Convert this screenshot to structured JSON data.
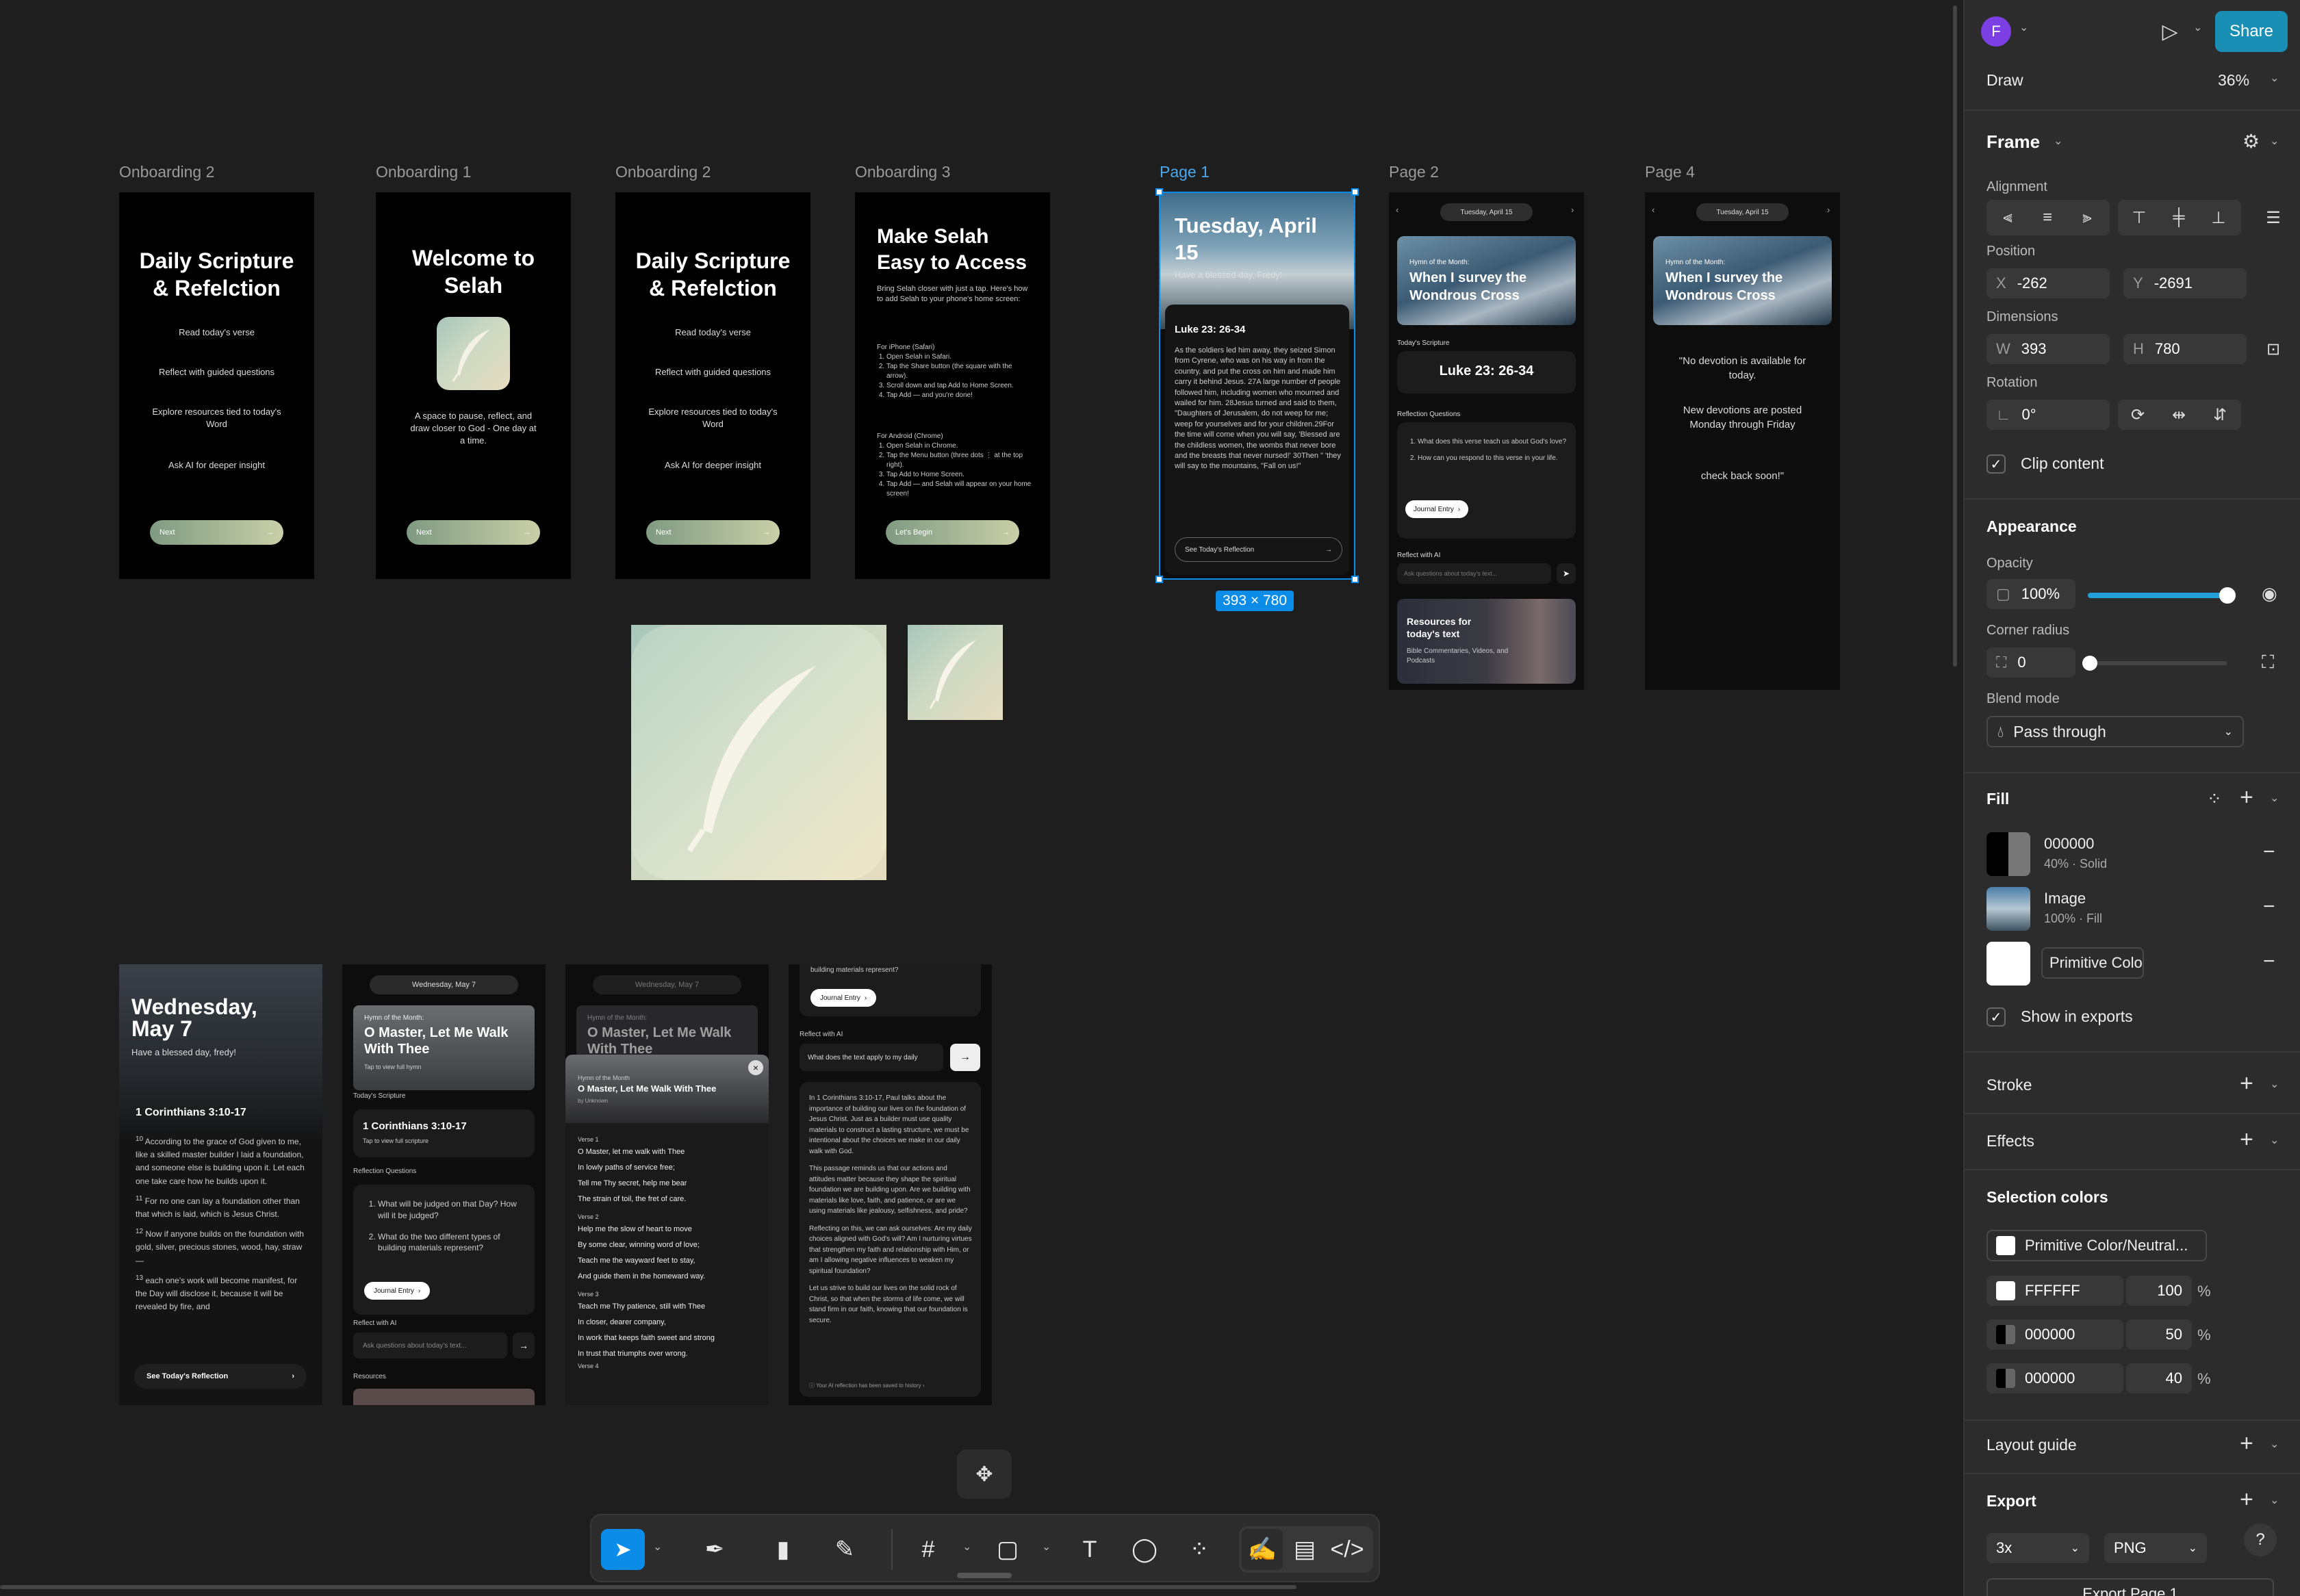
{
  "canvas": {
    "top_frames": [
      {
        "label": "Onboarding 2",
        "title": "Daily Scripture & Refelction",
        "items": [
          "Read today's verse",
          "Reflect with guided questions",
          "Explore resources tied to today's Word",
          "Ask AI for deeper insight"
        ],
        "button": "Next"
      },
      {
        "label": "Onboarding 1",
        "title": "Welcome to Selah",
        "body": "A space to pause, reflect, and draw closer to God - One day at a time.",
        "button": "Next"
      },
      {
        "label": "Onboarding 2",
        "title": "Daily Scripture & Refelction",
        "items": [
          "Read today's verse",
          "Reflect with guided questions",
          "Explore resources tied to today's Word",
          "Ask AI for deeper insight"
        ],
        "button": "Next"
      },
      {
        "label": "Onboarding 3",
        "title": "Make Selah Easy to Access",
        "intro": "Bring Selah closer with just a tap. Here's how to add Selah to your phone's home screen:",
        "iphone_head": "For iPhone (Safari)",
        "iphone_steps": [
          "Open Selah in Safari.",
          "Tap the Share button (the square with the arrow).",
          "Scroll down and tap Add to Home Screen.",
          "Tap Add — and you're done!"
        ],
        "android_head": "For Android (Chrome)",
        "android_steps": [
          "Open Selah in Chrome.",
          "Tap the Menu button (three dots ⋮ at the top right).",
          "Tap Add to Home Screen.",
          "Tap Add — and Selah will appear on your home screen!"
        ],
        "button": "Let's Begin"
      }
    ],
    "page1": {
      "label": "Page 1",
      "date": "Tuesday, April 15",
      "greeting": "Have a blessed day, Fredy!",
      "ref": "Luke 23: 26-34",
      "text": "As the soldiers led him away, they seized Simon from Cyrene, who was on his way in from the country, and put the cross on him and made him carry it behind Jesus. 27A large number of people followed him, including women who mourned and wailed for him. 28Jesus turned and said to them, \"Daughters of Jerusalem, do not weep for me; weep for yourselves and for your children.29For the time will come when you will say, 'Blessed are the childless women, the wombs that never bore and the breasts that never nursed!' 30Then \" 'they will say to the mountains, \"Fall on us!\"",
      "button": "See Today's Reflection",
      "size_badge": "393 × 780"
    },
    "page2": {
      "label": "Page 2",
      "date": "Tuesday, April 15",
      "hymn_kicker": "Hymn of the Month:",
      "hymn_title": "When I survey the Wondrous Cross",
      "scripture_label": "Today's Scripture",
      "scripture_ref": "Luke 23: 26-34",
      "reflection_label": "Reflection Questions",
      "questions": [
        "What does this verse teach us about God's love?",
        "How can you respond to this verse in your life."
      ],
      "journal": "Journal Entry",
      "ai_label": "Reflect with AI",
      "ai_placeholder": "Ask questions about today's text...",
      "res_title": "Resources for today's text",
      "res_sub": "Bible Commentaries, Videos, and Podcasts"
    },
    "page4": {
      "label": "Page 4",
      "date": "Tuesday, April 15",
      "hymn_kicker": "Hymn of the Month:",
      "hymn_title": "When I survey the Wondrous Cross",
      "msg1": "\"No devotion is available for today.",
      "msg2": "New devotions are posted Monday through Friday",
      "msg3": "check back soon!\""
    },
    "bottom": {
      "f1": {
        "date": "Wednesday, May 7",
        "greeting": "Have a blessed day, fredy!",
        "ref": "1 Corinthians 3:10-17",
        "verses": [
          {
            "n": "10",
            "t": "According to the grace of God given to me, like a skilled master builder I laid a foundation, and someone else is building upon it. Let each one take care how he builds upon it."
          },
          {
            "n": "11",
            "t": "For no one can lay a foundation other than that which is laid, which is Jesus Christ."
          },
          {
            "n": "12",
            "t": "Now if anyone builds on the foundation with gold, silver, precious stones, wood, hay, straw—"
          },
          {
            "n": "13",
            "t": "each one's work will become manifest, for the Day will disclose it, because it will be revealed by fire, and"
          }
        ],
        "button": "See Today's Reflection"
      },
      "f2": {
        "date": "Wednesday, May 7",
        "hymn_kicker": "Hymn of the Month:",
        "hymn_title": "O Master, Let Me Walk With Thee",
        "hymn_tap": "Tap to view full hymn",
        "scripture_label": "Today's Scripture",
        "ref": "1 Corinthians 3:10-17",
        "ref_tap": "Tap to view full scripture",
        "reflection_label": "Reflection Questions",
        "questions": [
          "What will be judged on that Day? How will it be judged?",
          "What do the two different types of building materials represent?"
        ],
        "journal": "Journal Entry",
        "ai_label": "Reflect with AI",
        "ai_placeholder": "Ask questions about today's text...",
        "resources": "Resources"
      },
      "f3": {
        "date": "Wednesday, May 7",
        "hymn_kicker": "Hymn of the Month:",
        "bg_title": "O Master, Let Me Walk With Thee",
        "modal_kicker": "Hymn of the Month",
        "modal_title": "O Master, Let Me Walk With Thee",
        "author": "by Unknown",
        "verses": [
          {
            "label": "Verse 1",
            "lines": [
              "O Master, let me walk with Thee",
              "In lowly paths of service free;",
              "Tell me Thy secret, help me bear",
              "The strain of toil, the fret of care."
            ]
          },
          {
            "label": "Verse 2",
            "lines": [
              "Help me the slow of heart to move",
              "By some clear, winning word of love;",
              "Teach me the wayward feet to stay,",
              "And guide them in the homeward way."
            ]
          },
          {
            "label": "Verse 3",
            "lines": [
              "Teach me Thy patience, still with Thee",
              "In closer, dearer company,",
              "In work that keeps faith sweet and strong",
              "In trust that triumphs over wrong."
            ]
          }
        ],
        "verse4": "Verse 4"
      },
      "f4": {
        "top_text": "building materials represent?",
        "journal": "Journal Entry",
        "ai_label": "Reflect with AI",
        "ai_value": "What does the text apply to my daily",
        "paras": [
          "In 1 Corinthians 3:10-17, Paul talks about the importance of building our lives on the foundation of Jesus Christ. Just as a builder must use quality materials to construct a lasting structure, we must be intentional about the choices we make in our daily walk with God.",
          "This passage reminds us that our actions and attitudes matter because they shape the spiritual foundation we are building upon. Are we building with materials like love, faith, and patience, or are we using materials like jealousy, selfishness, and pride?",
          "Reflecting on this, we can ask ourselves: Are my daily choices aligned with God's will? Am I nurturing virtues that strengthen my faith and relationship with Him, or am I allowing negative influences to weaken my spiritual foundation?",
          "Let us strive to build our lives on the solid rock of Christ, so that when the storms of life come, we will stand firm in our faith, knowing that our foundation is secure."
        ],
        "saved": "Your AI reflection has been saved to history"
      }
    }
  },
  "toolbar": {
    "tools": [
      "move-tool",
      "pen-tool",
      "marker-tool",
      "pencil-tool",
      "frame-tool",
      "shape-tool",
      "text-tool",
      "comment-tool",
      "components-tool",
      "draw-mode",
      "design-mode",
      "dev-mode"
    ]
  },
  "panel": {
    "avatar": "F",
    "share": "Share",
    "mode": "Draw",
    "zoom": "36%",
    "section_frame": "Frame",
    "alignment": "Alignment",
    "position": "Position",
    "x_label": "X",
    "x": "-262",
    "y_label": "Y",
    "y": "-2691",
    "dimensions": "Dimensions",
    "w_label": "W",
    "w": "393",
    "h_label": "H",
    "h": "780",
    "rotation": "Rotation",
    "rot": "0°",
    "clip": "Clip content",
    "appearance": "Appearance",
    "opacity_label": "Opacity",
    "opacity": "100%",
    "radius_label": "Corner radius",
    "radius": "0",
    "blend_label": "Blend mode",
    "blend": "Pass through",
    "fill": "Fill",
    "fills": [
      {
        "name": "000000",
        "sub": "40% · Solid"
      },
      {
        "name": "Image",
        "sub": "100% · Fill"
      },
      {
        "name": "Primitive Color/Neutral..."
      }
    ],
    "show_exports": "Show in exports",
    "stroke": "Stroke",
    "effects": "Effects",
    "selection_colors": "Selection colors",
    "sel_colors": [
      {
        "name": "Primitive Color/Neutral..."
      },
      {
        "name": "FFFFFF",
        "pct": "100",
        "unit": "%"
      },
      {
        "name": "000000",
        "pct": "50",
        "unit": "%"
      },
      {
        "name": "000000",
        "pct": "40",
        "unit": "%"
      }
    ],
    "layout_guide": "Layout guide",
    "export": "Export",
    "scale": "3x",
    "format": "PNG",
    "export_btn": "Export Page 1",
    "help": "?"
  },
  "colors": {
    "accent": "#0c8ce9",
    "share_bg": "#1a8fb5",
    "avatar": "#7b3fe4",
    "canvas": "#1e1e1e",
    "panel": "#2c2c2c"
  }
}
